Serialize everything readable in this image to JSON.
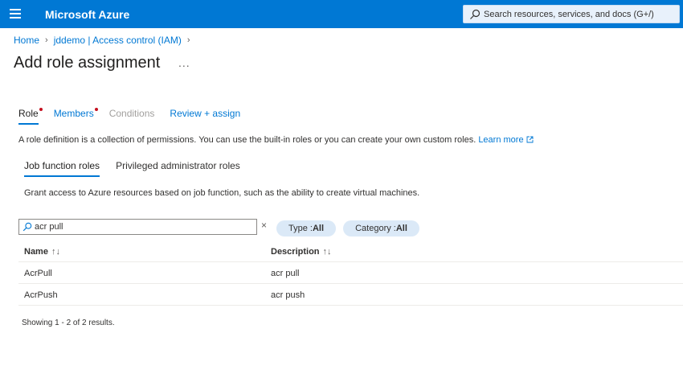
{
  "header": {
    "brand": "Microsoft Azure",
    "search_placeholder": "Search resources, services, and docs (G+/)",
    "accent_color": "#0078d4"
  },
  "breadcrumb": [
    "Home",
    "jddemo | Access control (IAM)"
  ],
  "page": {
    "title": "Add role assignment",
    "more": "..."
  },
  "tabs": [
    {
      "label": "Role",
      "state": "active",
      "required": true
    },
    {
      "label": "Members",
      "state": "normal",
      "required": true
    },
    {
      "label": "Conditions",
      "state": "disabled",
      "required": false
    },
    {
      "label": "Review + assign",
      "state": "normal",
      "required": false
    }
  ],
  "description": {
    "text": "A role definition is a collection of permissions. You can use the built-in roles or you can create your own custom roles.",
    "link": "Learn more"
  },
  "subtabs": [
    "Job function roles",
    "Privileged administrator roles"
  ],
  "grant_text": "Grant access to Azure resources based on job function, such as the ability to create virtual machines.",
  "filter": {
    "search_value": "acr pull",
    "clear": "×",
    "type_label": "Type : ",
    "type_value": "All",
    "category_label": "Category : ",
    "category_value": "All"
  },
  "table": {
    "columns": [
      "Name",
      "Description"
    ],
    "sort_icon": "↑↓",
    "rows": [
      {
        "name": "AcrPull",
        "description": "acr pull"
      },
      {
        "name": "AcrPush",
        "description": "acr push"
      }
    ]
  },
  "results_text": "Showing 1 - 2 of 2 results.",
  "icons": [
    "hamburger-icon",
    "search-icon",
    "chevron-right-icon",
    "external-link-icon",
    "close-icon",
    "sort-icon"
  ]
}
